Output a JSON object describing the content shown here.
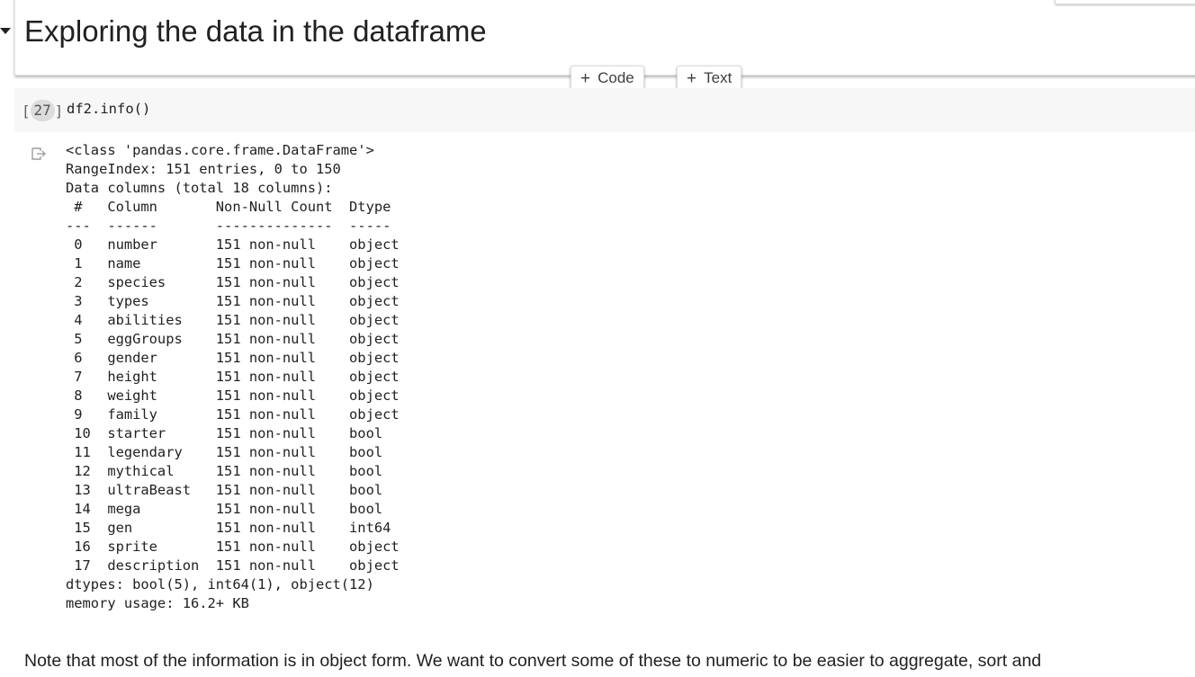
{
  "text_cell": {
    "heading": "Exploring the data in the dataframe"
  },
  "toolbar": {
    "add_code_label": "Code",
    "add_text_label": "Text",
    "plus_glyph": "+"
  },
  "code_cell": {
    "execution_count": "27",
    "code": "df2.info()"
  },
  "output": {
    "lines": [
      "<class 'pandas.core.frame.DataFrame'>",
      "RangeIndex: 151 entries, 0 to 150",
      "Data columns (total 18 columns):",
      " #   Column       Non-Null Count  Dtype ",
      "---  ------       --------------  ----- ",
      " 0   number       151 non-null    object",
      " 1   name         151 non-null    object",
      " 2   species      151 non-null    object",
      " 3   types        151 non-null    object",
      " 4   abilities    151 non-null    object",
      " 5   eggGroups    151 non-null    object",
      " 6   gender       151 non-null    object",
      " 7   height       151 non-null    object",
      " 8   weight       151 non-null    object",
      " 9   family       151 non-null    object",
      " 10  starter      151 non-null    bool  ",
      " 11  legendary    151 non-null    bool  ",
      " 12  mythical     151 non-null    bool  ",
      " 13  ultraBeast   151 non-null    bool  ",
      " 14  mega         151 non-null    bool  ",
      " 15  gen          151 non-null    int64 ",
      " 16  sprite       151 non-null    object",
      " 17  description  151 non-null    object",
      "dtypes: bool(5), int64(1), object(12)",
      "memory usage: 16.2+ KB"
    ]
  },
  "note_text": "Note that most of the information is in object form. We want to convert some of these to numeric to be easier to aggregate, sort and",
  "icons": {
    "collapse": "chevron-down-icon",
    "output": "output-redirect-icon"
  }
}
